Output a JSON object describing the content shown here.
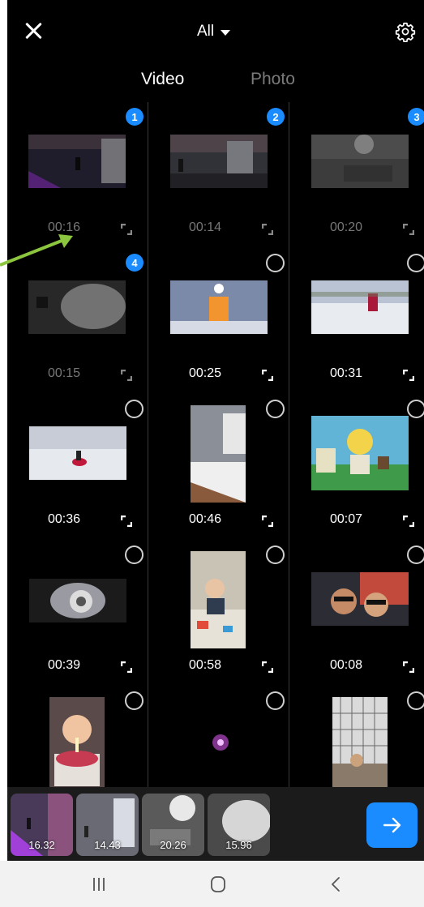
{
  "header": {
    "filter_label": "All"
  },
  "tabs": {
    "video": "Video",
    "photo": "Photo",
    "active": "video"
  },
  "grid": [
    {
      "duration": "00:16",
      "selected": 1,
      "dim": true
    },
    {
      "duration": "00:14",
      "selected": 2,
      "dim": true
    },
    {
      "duration": "00:20",
      "selected": 3,
      "dim": true
    },
    {
      "duration": "00:15",
      "selected": 4,
      "dim": true
    },
    {
      "duration": "00:25",
      "selected": null,
      "dim": false
    },
    {
      "duration": "00:31",
      "selected": null,
      "dim": false
    },
    {
      "duration": "00:36",
      "selected": null,
      "dim": false
    },
    {
      "duration": "00:46",
      "selected": null,
      "dim": false
    },
    {
      "duration": "00:07",
      "selected": null,
      "dim": false
    },
    {
      "duration": "00:39",
      "selected": null,
      "dim": false
    },
    {
      "duration": "00:58",
      "selected": null,
      "dim": false
    },
    {
      "duration": "00:08",
      "selected": null,
      "dim": false
    },
    {
      "duration": "",
      "selected": null,
      "dim": false
    },
    {
      "duration": "",
      "selected": null,
      "dim": false
    },
    {
      "duration": "",
      "selected": null,
      "dim": false
    }
  ],
  "tray": {
    "items": [
      {
        "duration": "16.32"
      },
      {
        "duration": "14.43"
      },
      {
        "duration": "20.26"
      },
      {
        "duration": "15.96"
      }
    ]
  },
  "icons": {
    "close": "close-icon",
    "filter_caret": "caret-down-icon",
    "settings": "gear-icon",
    "expand": "expand-icon",
    "next": "arrow-right-icon",
    "nav_recents": "recents-icon",
    "nav_home": "home-icon",
    "nav_back": "back-icon"
  },
  "colors": {
    "accent": "#1a8cff",
    "annotation_arrow": "#8cc63f",
    "background": "#000000"
  }
}
